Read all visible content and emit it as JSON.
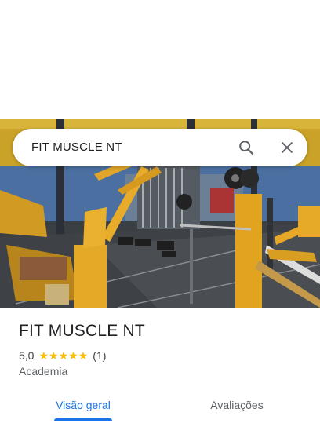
{
  "search": {
    "query": "FIT MUSCLE NT",
    "search_icon": "search-icon",
    "close_icon": "close-icon"
  },
  "place": {
    "name": "FIT MUSCLE NT",
    "rating": "5,0",
    "stars": 5,
    "review_count": "(1)",
    "category": "Academia"
  },
  "tabs": [
    {
      "label": "Visão geral",
      "active": true
    },
    {
      "label": "Avaliações",
      "active": false
    }
  ],
  "colors": {
    "accent": "#1a73e8",
    "star": "#fbbc04",
    "gym_yellow": "#e8a91c"
  }
}
